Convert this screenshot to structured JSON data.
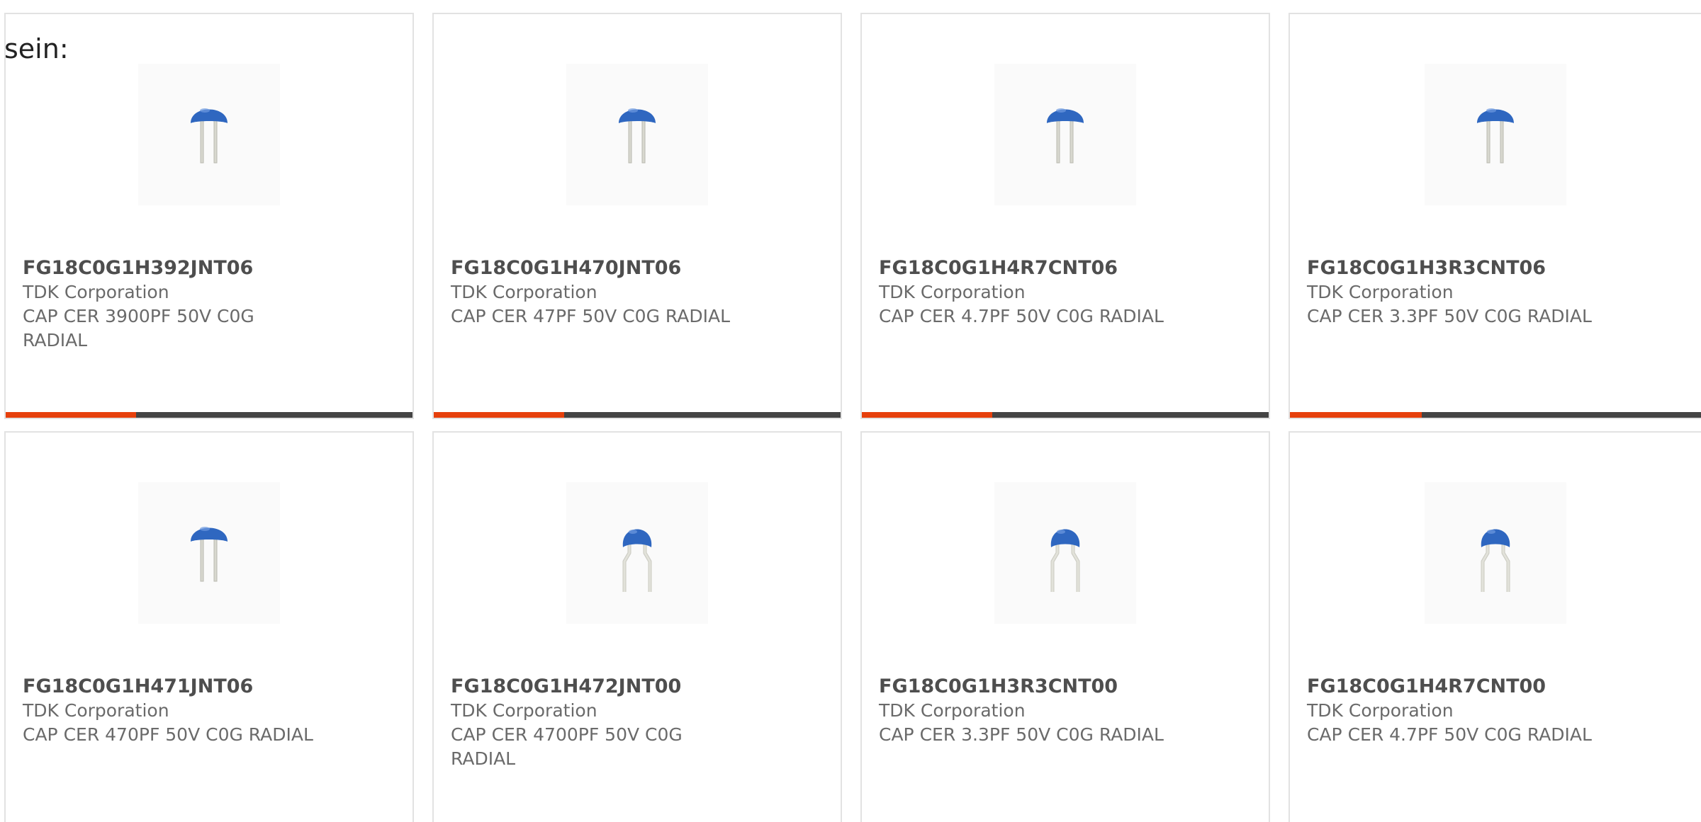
{
  "intro_text": "sein:",
  "products": [
    {
      "part": "FG18C0G1H392JNT06",
      "maker": "TDK Corporation",
      "desc": "CAP CER 3900PF 50V C0G RADIAL",
      "icon": "capacitor-straight-leads-icon",
      "progress": 0.32
    },
    {
      "part": "FG18C0G1H470JNT06",
      "maker": "TDK Corporation",
      "desc": "CAP CER 47PF 50V C0G RADIAL",
      "icon": "capacitor-straight-leads-icon",
      "progress": 0.32
    },
    {
      "part": "FG18C0G1H4R7CNT06",
      "maker": "TDK Corporation",
      "desc": "CAP CER 4.7PF 50V C0G RADIAL",
      "icon": "capacitor-straight-leads-icon",
      "progress": 0.32
    },
    {
      "part": "FG18C0G1H3R3CNT06",
      "maker": "TDK Corporation",
      "desc": "CAP CER 3.3PF 50V C0G RADIAL",
      "icon": "capacitor-straight-leads-icon",
      "progress": 0.32
    },
    {
      "part": "FG18C0G1H471JNT06",
      "maker": "TDK Corporation",
      "desc": "CAP CER 470PF 50V C0G RADIAL",
      "icon": "capacitor-straight-leads-icon"
    },
    {
      "part": "FG18C0G1H472JNT00",
      "maker": "TDK Corporation",
      "desc": "CAP CER 4700PF 50V C0G RADIAL",
      "icon": "capacitor-bent-leads-icon"
    },
    {
      "part": "FG18C0G1H3R3CNT00",
      "maker": "TDK Corporation",
      "desc": "CAP CER 3.3PF 50V C0G RADIAL",
      "icon": "capacitor-bent-leads-icon"
    },
    {
      "part": "FG18C0G1H4R7CNT00",
      "maker": "TDK Corporation",
      "desc": "CAP CER 4.7PF 50V C0G RADIAL",
      "icon": "capacitor-bent-leads-icon"
    }
  ],
  "colors": {
    "accent": "#e6400c",
    "bar_track": "#444444",
    "capacitor_body": "#2f67c0",
    "lead": "#d8d8cf"
  }
}
